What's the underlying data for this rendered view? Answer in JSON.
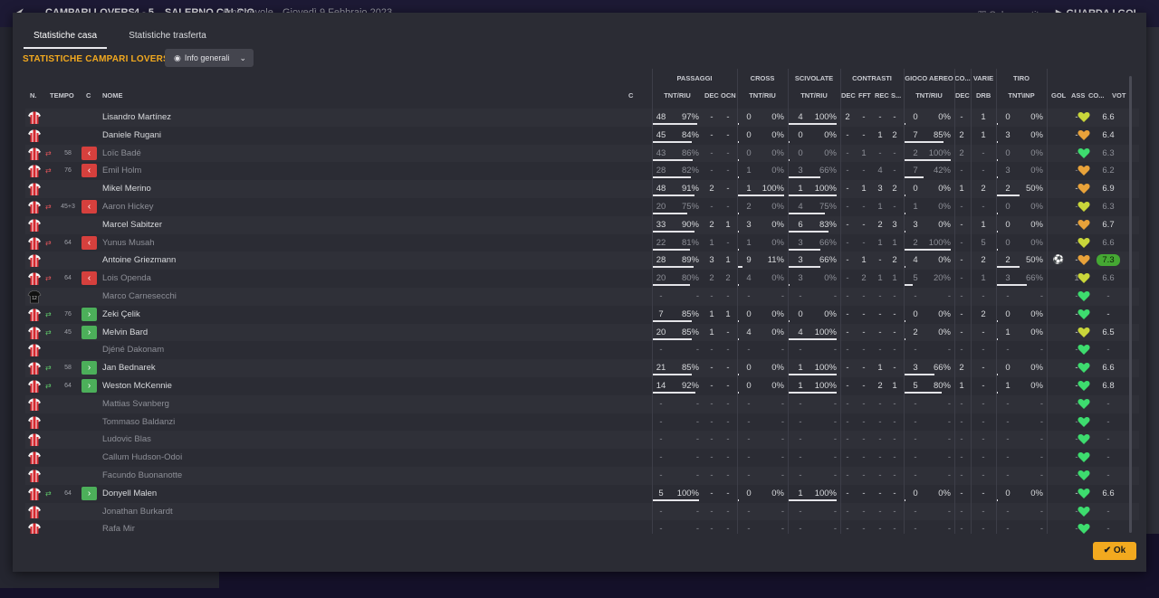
{
  "header": {
    "match": "CAMPARI LOVERS",
    "score": "4 - 5",
    "opponent": "SALERNO CALCIO",
    "type": "Amichevole",
    "date": "Giovedì 9 Febbraio 2023",
    "save_label": "Salva partita",
    "watch_label": "GUARDA I GOL"
  },
  "tabs": [
    {
      "label": "Statistiche casa",
      "active": true
    },
    {
      "label": "Statistiche trasferta",
      "active": false
    }
  ],
  "section_title": "STATISTICHE CAMPARI LOVERS",
  "view_dropdown": {
    "label": "Info generali"
  },
  "groups": {
    "passaggi": "PASSAGGI",
    "cross": "CROSS",
    "scivolate": "SCIVOLATE",
    "contrasti": "CONTRASTI",
    "gioco_aereo": "GIOCO AEREO",
    "co": "CO...",
    "varie": "VARIE",
    "tiro": "TIRO"
  },
  "columns": {
    "n": "N.",
    "tempo": "TEMPO",
    "c": "C",
    "nome": "NOME",
    "c2": "C",
    "pass_tr": "TNT/RIU",
    "pass_dec": "DEC",
    "pass_ocn": "OCN",
    "cross_tr": "TNT/RIU",
    "sciv_tr": "TNT/RIU",
    "con_dec": "DEC",
    "con_fft": "FFT",
    "con_rec": "REC",
    "con_s": "S...",
    "aer_tr": "TNT/RIU",
    "co_dec": "DEC",
    "drb": "DRB",
    "tiro_ti": "TNT\\INP",
    "gol": "GOL",
    "ass": "ASS",
    "cond": "CO...",
    "vot": "VOT"
  },
  "colors": {
    "accent": "#f2a91f",
    "sub_out": "#d6403d",
    "sub_in": "#4caf5a",
    "heart_green": "#3ddc6e",
    "heart_yellow": "#c9d63a",
    "heart_orange": "#e8a23a",
    "rating_highlight": "#45a833"
  },
  "players": [
    {
      "name": "Lisandro Martínez",
      "sub": "",
      "mins": "",
      "pass_t": "48",
      "pass_p": "97%",
      "pass_pct": 97,
      "dec": "-",
      "ocn": "-",
      "cross_t": "0",
      "cross_p": "0%",
      "cross_pct": 0,
      "sciv_t": "4",
      "sciv_p": "100%",
      "sciv_pct": 100,
      "c_dec": "2",
      "c_fft": "-",
      "c_rec": "-",
      "c_s": "-",
      "aer_t": "0",
      "aer_p": "0%",
      "aer_pct": 0,
      "co_dec": "-",
      "drb": "1",
      "tiro_t": "0",
      "tiro_p": "0%",
      "tiro_pct": 0,
      "gol": "",
      "ass": "-",
      "cond": "yellow",
      "vot": "6.6",
      "dim": false,
      "hl": false
    },
    {
      "name": "Daniele Rugani",
      "sub": "",
      "mins": "",
      "pass_t": "45",
      "pass_p": "84%",
      "pass_pct": 84,
      "dec": "-",
      "ocn": "-",
      "cross_t": "0",
      "cross_p": "0%",
      "cross_pct": 0,
      "sciv_t": "0",
      "sciv_p": "0%",
      "sciv_pct": 0,
      "c_dec": "-",
      "c_fft": "-",
      "c_rec": "1",
      "c_s": "2",
      "aer_t": "7",
      "aer_p": "85%",
      "aer_pct": 85,
      "co_dec": "2",
      "drb": "1",
      "tiro_t": "3",
      "tiro_p": "0%",
      "tiro_pct": 0,
      "gol": "",
      "ass": "-",
      "cond": "orange",
      "vot": "6.4",
      "dim": false,
      "hl": false
    },
    {
      "name": "Loïc Badé",
      "sub": "out",
      "mins": "58",
      "pass_t": "43",
      "pass_p": "86%",
      "pass_pct": 86,
      "dec": "-",
      "ocn": "-",
      "cross_t": "0",
      "cross_p": "0%",
      "cross_pct": 0,
      "sciv_t": "0",
      "sciv_p": "0%",
      "sciv_pct": 0,
      "c_dec": "-",
      "c_fft": "1",
      "c_rec": "-",
      "c_s": "-",
      "aer_t": "2",
      "aer_p": "100%",
      "aer_pct": 100,
      "co_dec": "2",
      "drb": "-",
      "tiro_t": "0",
      "tiro_p": "0%",
      "tiro_pct": 0,
      "gol": "",
      "ass": "-",
      "cond": "green",
      "vot": "6.3",
      "dim": true,
      "hl": false
    },
    {
      "name": "Emil Holm",
      "sub": "out",
      "mins": "76",
      "pass_t": "28",
      "pass_p": "82%",
      "pass_pct": 82,
      "dec": "-",
      "ocn": "-",
      "cross_t": "1",
      "cross_p": "0%",
      "cross_pct": 0,
      "sciv_t": "3",
      "sciv_p": "66%",
      "sciv_pct": 66,
      "c_dec": "-",
      "c_fft": "-",
      "c_rec": "4",
      "c_s": "-",
      "aer_t": "7",
      "aer_p": "42%",
      "aer_pct": 42,
      "co_dec": "-",
      "drb": "-",
      "tiro_t": "3",
      "tiro_p": "0%",
      "tiro_pct": 0,
      "gol": "",
      "ass": "-",
      "cond": "orange",
      "vot": "6.2",
      "dim": true,
      "hl": false
    },
    {
      "name": "Mikel Merino",
      "sub": "",
      "mins": "",
      "pass_t": "48",
      "pass_p": "91%",
      "pass_pct": 91,
      "dec": "2",
      "ocn": "-",
      "cross_t": "1",
      "cross_p": "100%",
      "cross_pct": 100,
      "sciv_t": "1",
      "sciv_p": "100%",
      "sciv_pct": 100,
      "c_dec": "-",
      "c_fft": "1",
      "c_rec": "3",
      "c_s": "2",
      "aer_t": "0",
      "aer_p": "0%",
      "aer_pct": 0,
      "co_dec": "1",
      "drb": "2",
      "tiro_t": "2",
      "tiro_p": "50%",
      "tiro_pct": 50,
      "gol": "",
      "ass": "-",
      "cond": "orange",
      "vot": "6.9",
      "dim": false,
      "hl": false
    },
    {
      "name": "Aaron Hickey",
      "sub": "out",
      "mins": "45+3",
      "pass_t": "20",
      "pass_p": "75%",
      "pass_pct": 75,
      "dec": "-",
      "ocn": "-",
      "cross_t": "2",
      "cross_p": "0%",
      "cross_pct": 0,
      "sciv_t": "4",
      "sciv_p": "75%",
      "sciv_pct": 75,
      "c_dec": "-",
      "c_fft": "-",
      "c_rec": "1",
      "c_s": "-",
      "aer_t": "1",
      "aer_p": "0%",
      "aer_pct": 0,
      "co_dec": "-",
      "drb": "-",
      "tiro_t": "0",
      "tiro_p": "0%",
      "tiro_pct": 0,
      "gol": "",
      "ass": "-",
      "cond": "yellow",
      "vot": "6.3",
      "dim": true,
      "hl": false
    },
    {
      "name": "Marcel Sabitzer",
      "sub": "",
      "mins": "",
      "pass_t": "33",
      "pass_p": "90%",
      "pass_pct": 90,
      "dec": "2",
      "ocn": "1",
      "cross_t": "3",
      "cross_p": "0%",
      "cross_pct": 0,
      "sciv_t": "6",
      "sciv_p": "83%",
      "sciv_pct": 83,
      "c_dec": "-",
      "c_fft": "-",
      "c_rec": "2",
      "c_s": "3",
      "aer_t": "3",
      "aer_p": "0%",
      "aer_pct": 0,
      "co_dec": "-",
      "drb": "1",
      "tiro_t": "0",
      "tiro_p": "0%",
      "tiro_pct": 0,
      "gol": "",
      "ass": "-",
      "cond": "orange",
      "vot": "6.7",
      "dim": false,
      "hl": false
    },
    {
      "name": "Yunus Musah",
      "sub": "out",
      "mins": "64",
      "pass_t": "22",
      "pass_p": "81%",
      "pass_pct": 81,
      "dec": "1",
      "ocn": "-",
      "cross_t": "1",
      "cross_p": "0%",
      "cross_pct": 0,
      "sciv_t": "3",
      "sciv_p": "66%",
      "sciv_pct": 66,
      "c_dec": "-",
      "c_fft": "-",
      "c_rec": "1",
      "c_s": "1",
      "aer_t": "2",
      "aer_p": "100%",
      "aer_pct": 100,
      "co_dec": "-",
      "drb": "5",
      "tiro_t": "0",
      "tiro_p": "0%",
      "tiro_pct": 0,
      "gol": "",
      "ass": "-",
      "cond": "yellow",
      "vot": "6.6",
      "dim": true,
      "hl": false
    },
    {
      "name": "Antoine Griezmann",
      "sub": "",
      "mins": "",
      "pass_t": "28",
      "pass_p": "89%",
      "pass_pct": 89,
      "dec": "3",
      "ocn": "1",
      "cross_t": "9",
      "cross_p": "11%",
      "cross_pct": 11,
      "sciv_t": "3",
      "sciv_p": "66%",
      "sciv_pct": 66,
      "c_dec": "-",
      "c_fft": "1",
      "c_rec": "-",
      "c_s": "2",
      "aer_t": "4",
      "aer_p": "0%",
      "aer_pct": 0,
      "co_dec": "-",
      "drb": "2",
      "tiro_t": "2",
      "tiro_p": "50%",
      "tiro_pct": 50,
      "gol": "ball",
      "ass": "-",
      "cond": "orange",
      "vot": "7.3",
      "dim": false,
      "hl": true
    },
    {
      "name": "Lois Openda",
      "sub": "out",
      "mins": "64",
      "pass_t": "20",
      "pass_p": "80%",
      "pass_pct": 80,
      "dec": "2",
      "ocn": "2",
      "cross_t": "4",
      "cross_p": "0%",
      "cross_pct": 0,
      "sciv_t": "3",
      "sciv_p": "0%",
      "sciv_pct": 0,
      "c_dec": "-",
      "c_fft": "2",
      "c_rec": "1",
      "c_s": "1",
      "aer_t": "5",
      "aer_p": "20%",
      "aer_pct": 20,
      "co_dec": "-",
      "drb": "1",
      "tiro_t": "3",
      "tiro_p": "66%",
      "tiro_pct": 66,
      "gol": "",
      "ass": "1",
      "cond": "yellow",
      "vot": "6.6",
      "dim": true,
      "hl": false
    },
    {
      "name": "Marco Carnesecchi",
      "sub": "",
      "mins": "",
      "gk": true,
      "pass_t": "-",
      "pass_p": "-",
      "pass_pct": -1,
      "dec": "-",
      "ocn": "-",
      "cross_t": "-",
      "cross_p": "-",
      "cross_pct": -1,
      "sciv_t": "-",
      "sciv_p": "-",
      "sciv_pct": -1,
      "c_dec": "-",
      "c_fft": "-",
      "c_rec": "-",
      "c_s": "-",
      "aer_t": "-",
      "aer_p": "-",
      "aer_pct": -1,
      "co_dec": "-",
      "drb": "-",
      "tiro_t": "-",
      "tiro_p": "-",
      "tiro_pct": -1,
      "gol": "",
      "ass": "-",
      "cond": "green",
      "vot": "-",
      "dim": true,
      "hl": false
    },
    {
      "name": "Zeki Çelik",
      "sub": "in",
      "mins": "76",
      "pass_t": "7",
      "pass_p": "85%",
      "pass_pct": 85,
      "dec": "1",
      "ocn": "1",
      "cross_t": "0",
      "cross_p": "0%",
      "cross_pct": 0,
      "sciv_t": "0",
      "sciv_p": "0%",
      "sciv_pct": 0,
      "c_dec": "-",
      "c_fft": "-",
      "c_rec": "-",
      "c_s": "-",
      "aer_t": "0",
      "aer_p": "0%",
      "aer_pct": 0,
      "co_dec": "-",
      "drb": "2",
      "tiro_t": "0",
      "tiro_p": "0%",
      "tiro_pct": 0,
      "gol": "",
      "ass": "-",
      "cond": "green",
      "vot": "-",
      "dim": false,
      "hl": false
    },
    {
      "name": "Melvin Bard",
      "sub": "in",
      "mins": "45",
      "pass_t": "20",
      "pass_p": "85%",
      "pass_pct": 85,
      "dec": "1",
      "ocn": "-",
      "cross_t": "4",
      "cross_p": "0%",
      "cross_pct": 0,
      "sciv_t": "4",
      "sciv_p": "100%",
      "sciv_pct": 100,
      "c_dec": "-",
      "c_fft": "-",
      "c_rec": "-",
      "c_s": "-",
      "aer_t": "2",
      "aer_p": "0%",
      "aer_pct": 0,
      "co_dec": "-",
      "drb": "-",
      "tiro_t": "1",
      "tiro_p": "0%",
      "tiro_pct": 0,
      "gol": "",
      "ass": "-",
      "cond": "yellow",
      "vot": "6.5",
      "dim": false,
      "hl": false
    },
    {
      "name": "Djéné Dakonam",
      "sub": "",
      "mins": "",
      "pass_t": "-",
      "pass_p": "-",
      "pass_pct": -1,
      "dec": "-",
      "ocn": "-",
      "cross_t": "-",
      "cross_p": "-",
      "cross_pct": -1,
      "sciv_t": "-",
      "sciv_p": "-",
      "sciv_pct": -1,
      "c_dec": "-",
      "c_fft": "-",
      "c_rec": "-",
      "c_s": "-",
      "aer_t": "-",
      "aer_p": "-",
      "aer_pct": -1,
      "co_dec": "-",
      "drb": "-",
      "tiro_t": "-",
      "tiro_p": "-",
      "tiro_pct": -1,
      "gol": "",
      "ass": "-",
      "cond": "green",
      "vot": "-",
      "dim": true,
      "hl": false
    },
    {
      "name": "Jan Bednarek",
      "sub": "in",
      "mins": "58",
      "pass_t": "21",
      "pass_p": "85%",
      "pass_pct": 85,
      "dec": "-",
      "ocn": "-",
      "cross_t": "0",
      "cross_p": "0%",
      "cross_pct": 0,
      "sciv_t": "1",
      "sciv_p": "100%",
      "sciv_pct": 100,
      "c_dec": "-",
      "c_fft": "-",
      "c_rec": "1",
      "c_s": "-",
      "aer_t": "3",
      "aer_p": "66%",
      "aer_pct": 66,
      "co_dec": "2",
      "drb": "-",
      "tiro_t": "0",
      "tiro_p": "0%",
      "tiro_pct": 0,
      "gol": "",
      "ass": "-",
      "cond": "green",
      "vot": "6.6",
      "dim": false,
      "hl": false
    },
    {
      "name": "Weston McKennie",
      "sub": "in",
      "mins": "64",
      "pass_t": "14",
      "pass_p": "92%",
      "pass_pct": 92,
      "dec": "-",
      "ocn": "-",
      "cross_t": "0",
      "cross_p": "0%",
      "cross_pct": 0,
      "sciv_t": "1",
      "sciv_p": "100%",
      "sciv_pct": 100,
      "c_dec": "-",
      "c_fft": "-",
      "c_rec": "2",
      "c_s": "1",
      "aer_t": "5",
      "aer_p": "80%",
      "aer_pct": 80,
      "co_dec": "1",
      "drb": "-",
      "tiro_t": "1",
      "tiro_p": "0%",
      "tiro_pct": 0,
      "gol": "",
      "ass": "-",
      "cond": "green",
      "vot": "6.8",
      "dim": false,
      "hl": false
    },
    {
      "name": "Mattias Svanberg",
      "sub": "",
      "mins": "",
      "pass_t": "-",
      "pass_p": "-",
      "pass_pct": -1,
      "dec": "-",
      "ocn": "-",
      "cross_t": "-",
      "cross_p": "-",
      "cross_pct": -1,
      "sciv_t": "-",
      "sciv_p": "-",
      "sciv_pct": -1,
      "c_dec": "-",
      "c_fft": "-",
      "c_rec": "-",
      "c_s": "-",
      "aer_t": "-",
      "aer_p": "-",
      "aer_pct": -1,
      "co_dec": "-",
      "drb": "-",
      "tiro_t": "-",
      "tiro_p": "-",
      "tiro_pct": -1,
      "gol": "",
      "ass": "-",
      "cond": "green",
      "vot": "-",
      "dim": true,
      "hl": false
    },
    {
      "name": "Tommaso Baldanzi",
      "sub": "",
      "mins": "",
      "pass_t": "-",
      "pass_p": "-",
      "pass_pct": -1,
      "dec": "-",
      "ocn": "-",
      "cross_t": "-",
      "cross_p": "-",
      "cross_pct": -1,
      "sciv_t": "-",
      "sciv_p": "-",
      "sciv_pct": -1,
      "c_dec": "-",
      "c_fft": "-",
      "c_rec": "-",
      "c_s": "-",
      "aer_t": "-",
      "aer_p": "-",
      "aer_pct": -1,
      "co_dec": "-",
      "drb": "-",
      "tiro_t": "-",
      "tiro_p": "-",
      "tiro_pct": -1,
      "gol": "",
      "ass": "-",
      "cond": "green",
      "vot": "-",
      "dim": true,
      "hl": false
    },
    {
      "name": "Ludovic Blas",
      "sub": "",
      "mins": "",
      "pass_t": "-",
      "pass_p": "-",
      "pass_pct": -1,
      "dec": "-",
      "ocn": "-",
      "cross_t": "-",
      "cross_p": "-",
      "cross_pct": -1,
      "sciv_t": "-",
      "sciv_p": "-",
      "sciv_pct": -1,
      "c_dec": "-",
      "c_fft": "-",
      "c_rec": "-",
      "c_s": "-",
      "aer_t": "-",
      "aer_p": "-",
      "aer_pct": -1,
      "co_dec": "-",
      "drb": "-",
      "tiro_t": "-",
      "tiro_p": "-",
      "tiro_pct": -1,
      "gol": "",
      "ass": "-",
      "cond": "green",
      "vot": "-",
      "dim": true,
      "hl": false
    },
    {
      "name": "Callum Hudson-Odoi",
      "sub": "",
      "mins": "",
      "pass_t": "-",
      "pass_p": "-",
      "pass_pct": -1,
      "dec": "-",
      "ocn": "-",
      "cross_t": "-",
      "cross_p": "-",
      "cross_pct": -1,
      "sciv_t": "-",
      "sciv_p": "-",
      "sciv_pct": -1,
      "c_dec": "-",
      "c_fft": "-",
      "c_rec": "-",
      "c_s": "-",
      "aer_t": "-",
      "aer_p": "-",
      "aer_pct": -1,
      "co_dec": "-",
      "drb": "-",
      "tiro_t": "-",
      "tiro_p": "-",
      "tiro_pct": -1,
      "gol": "",
      "ass": "-",
      "cond": "green",
      "vot": "-",
      "dim": true,
      "hl": false
    },
    {
      "name": "Facundo Buonanotte",
      "sub": "",
      "mins": "",
      "pass_t": "-",
      "pass_p": "-",
      "pass_pct": -1,
      "dec": "-",
      "ocn": "-",
      "cross_t": "-",
      "cross_p": "-",
      "cross_pct": -1,
      "sciv_t": "-",
      "sciv_p": "-",
      "sciv_pct": -1,
      "c_dec": "-",
      "c_fft": "-",
      "c_rec": "-",
      "c_s": "-",
      "aer_t": "-",
      "aer_p": "-",
      "aer_pct": -1,
      "co_dec": "-",
      "drb": "-",
      "tiro_t": "-",
      "tiro_p": "-",
      "tiro_pct": -1,
      "gol": "",
      "ass": "-",
      "cond": "green",
      "vot": "-",
      "dim": true,
      "hl": false
    },
    {
      "name": "Donyell Malen",
      "sub": "in",
      "mins": "64",
      "pass_t": "5",
      "pass_p": "100%",
      "pass_pct": 100,
      "dec": "-",
      "ocn": "-",
      "cross_t": "0",
      "cross_p": "0%",
      "cross_pct": 0,
      "sciv_t": "1",
      "sciv_p": "100%",
      "sciv_pct": 100,
      "c_dec": "-",
      "c_fft": "-",
      "c_rec": "-",
      "c_s": "-",
      "aer_t": "0",
      "aer_p": "0%",
      "aer_pct": 0,
      "co_dec": "-",
      "drb": "-",
      "tiro_t": "0",
      "tiro_p": "0%",
      "tiro_pct": 0,
      "gol": "",
      "ass": "-",
      "cond": "green",
      "vot": "6.6",
      "dim": false,
      "hl": false
    },
    {
      "name": "Jonathan Burkardt",
      "sub": "",
      "mins": "",
      "pass_t": "-",
      "pass_p": "-",
      "pass_pct": -1,
      "dec": "-",
      "ocn": "-",
      "cross_t": "-",
      "cross_p": "-",
      "cross_pct": -1,
      "sciv_t": "-",
      "sciv_p": "-",
      "sciv_pct": -1,
      "c_dec": "-",
      "c_fft": "-",
      "c_rec": "-",
      "c_s": "-",
      "aer_t": "-",
      "aer_p": "-",
      "aer_pct": -1,
      "co_dec": "-",
      "drb": "-",
      "tiro_t": "-",
      "tiro_p": "-",
      "tiro_pct": -1,
      "gol": "",
      "ass": "-",
      "cond": "green",
      "vot": "-",
      "dim": true,
      "hl": false
    },
    {
      "name": "Rafa Mir",
      "sub": "",
      "mins": "",
      "pass_t": "-",
      "pass_p": "-",
      "pass_pct": -1,
      "dec": "-",
      "ocn": "-",
      "cross_t": "-",
      "cross_p": "-",
      "cross_pct": -1,
      "sciv_t": "-",
      "sciv_p": "-",
      "sciv_pct": -1,
      "c_dec": "-",
      "c_fft": "-",
      "c_rec": "-",
      "c_s": "-",
      "aer_t": "-",
      "aer_p": "-",
      "aer_pct": -1,
      "co_dec": "-",
      "drb": "-",
      "tiro_t": "-",
      "tiro_p": "-",
      "tiro_pct": -1,
      "gol": "",
      "ass": "-",
      "cond": "green",
      "vot": "-",
      "dim": true,
      "hl": false
    }
  ],
  "ok_label": "Ok"
}
